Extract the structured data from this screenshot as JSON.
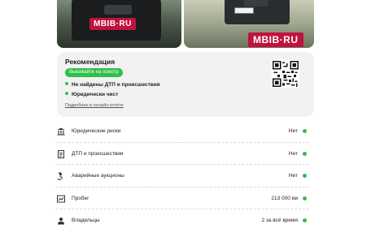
{
  "photos": [
    {
      "watermark": "MBIB·RU"
    },
    {
      "watermark": "MBIB·RU"
    }
  ],
  "recommendation": {
    "title": "Рекомендация",
    "badge": "Выезжайте на осмотр",
    "bullets": [
      "Не найдены ДТП и происшествия",
      "Юридически чист"
    ],
    "link": "Подробнее в онлайн-отчёте"
  },
  "report_rows": [
    {
      "icon": "bank-icon",
      "label": "Юридические риски",
      "value": "Нет"
    },
    {
      "icon": "document-icon",
      "label": "ДТП и происшествия",
      "value": "Нет"
    },
    {
      "icon": "auction-gavel-icon",
      "label": "Аварийные аукционы",
      "value": "Нет"
    },
    {
      "icon": "mileage-chart-icon",
      "label": "Пробег",
      "value": "213 000 км"
    },
    {
      "icon": "owner-person-icon",
      "label": "Владельцы",
      "value": "2 за всё время"
    }
  ],
  "colors": {
    "accent_green": "#2fbf4a",
    "watermark_red": "#c0123f",
    "card_bg": "#f2f2f3"
  }
}
